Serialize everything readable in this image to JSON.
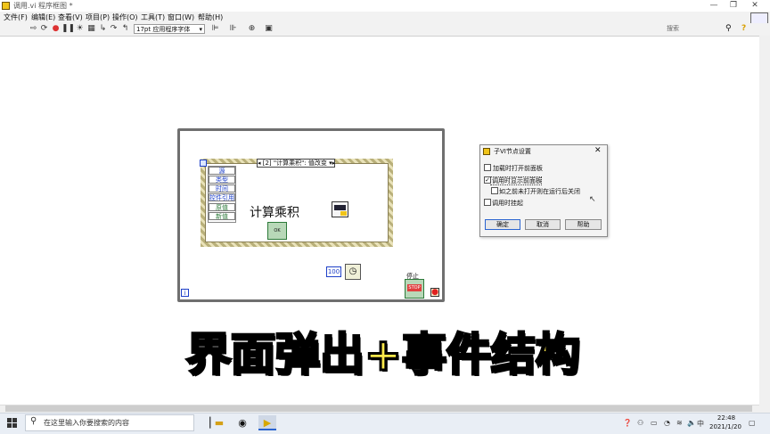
{
  "window": {
    "title": "调用.vi 程序框图 *",
    "controls": [
      "—",
      "❐",
      "✕"
    ]
  },
  "menu": [
    "文件(F)",
    "编辑(E)",
    "查看(V)",
    "项目(P)",
    "操作(O)",
    "工具(T)",
    "窗口(W)",
    "帮助(H)"
  ],
  "toolbar": {
    "font": "17pt 应用程序字体",
    "search_placeholder": "搜索"
  },
  "diagram": {
    "event_selector": "[2] \"计算乘积\": 值改变",
    "event_data": [
      "源",
      "类型",
      "时间",
      "控件引用",
      "原值",
      "新值"
    ],
    "label_main": "计算乘积",
    "ok_text": "OK",
    "wait_value": "100",
    "stop_label": "停止",
    "stop_text": "STOP",
    "loop_index": "i"
  },
  "dialog": {
    "title": "子VI节点设置",
    "options": [
      {
        "label": "加载时打开前面板",
        "checked": false
      },
      {
        "label": "调用时显示前面板",
        "checked": true
      },
      {
        "label": "如之前未打开则在运行后关闭",
        "checked": false
      },
      {
        "label": "调用时挂起",
        "checked": false
      }
    ],
    "buttons": {
      "ok": "确定",
      "cancel": "取消",
      "help": "帮助"
    }
  },
  "banner": "界面弹出+事件结构",
  "taskbar": {
    "search_placeholder": "在这里输入你要搜索的内容",
    "ime": "中",
    "time": "22:48",
    "date": "2021/1/20"
  }
}
